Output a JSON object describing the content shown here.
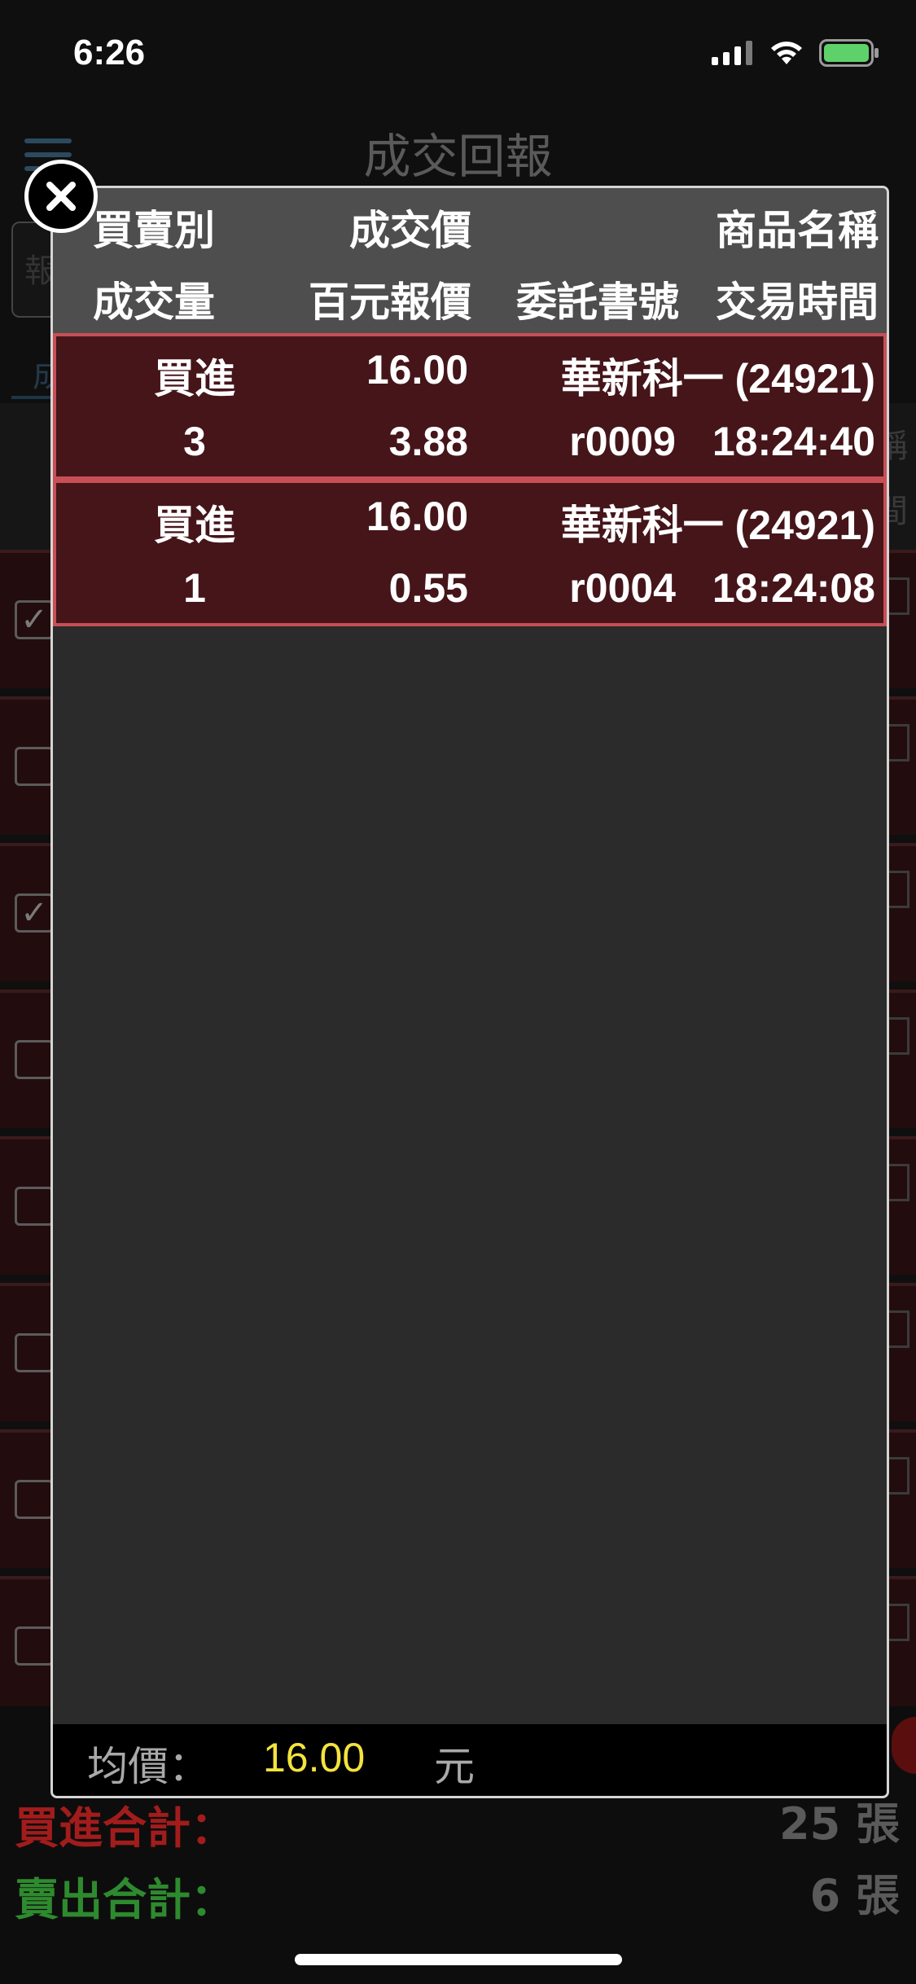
{
  "status_bar": {
    "time": "6:26"
  },
  "background": {
    "title": "成交回報",
    "search_placeholder": "報",
    "tab_label": "成",
    "right_glyph_1": "稱",
    "right_glyph_2": "間",
    "row_checks": [
      "✓",
      "",
      "✓",
      "",
      "",
      "",
      "",
      ""
    ],
    "footer": {
      "buy_total_label": "買進合計：",
      "buy_total_value": "25 張",
      "sell_total_label": "賣出合計：",
      "sell_total_value": "6 張"
    }
  },
  "dialog": {
    "headers": {
      "row1": {
        "col1": "買賣別",
        "col2": "成交價",
        "col4": "商品名稱"
      },
      "row2": {
        "col1": "成交量",
        "col2": "百元報價",
        "col3": "委託書號",
        "col4": "交易時間"
      }
    },
    "trades": [
      {
        "side": "買進",
        "price": "16.00",
        "product": "華新科一 (24921)",
        "qty": "3",
        "quote": "3.88",
        "order_no": "r0009",
        "time": "18:24:40"
      },
      {
        "side": "買進",
        "price": "16.00",
        "product": "華新科一 (24921)",
        "qty": "1",
        "quote": "0.55",
        "order_no": "r0004",
        "time": "18:24:08"
      }
    ],
    "footer": {
      "avg_label": "均價：",
      "avg_value": "16.00",
      "avg_unit": "元"
    }
  },
  "colors": {
    "row_bg": "#45151a",
    "row_border": "#c74f55",
    "avg_value": "#f3e33d",
    "buy_total": "#a21c1c",
    "sell_total": "#2e8a2e"
  },
  "icons": {
    "close": "close-icon",
    "signal": "cellular-signal-icon",
    "wifi": "wifi-icon",
    "battery": "battery-icon"
  }
}
